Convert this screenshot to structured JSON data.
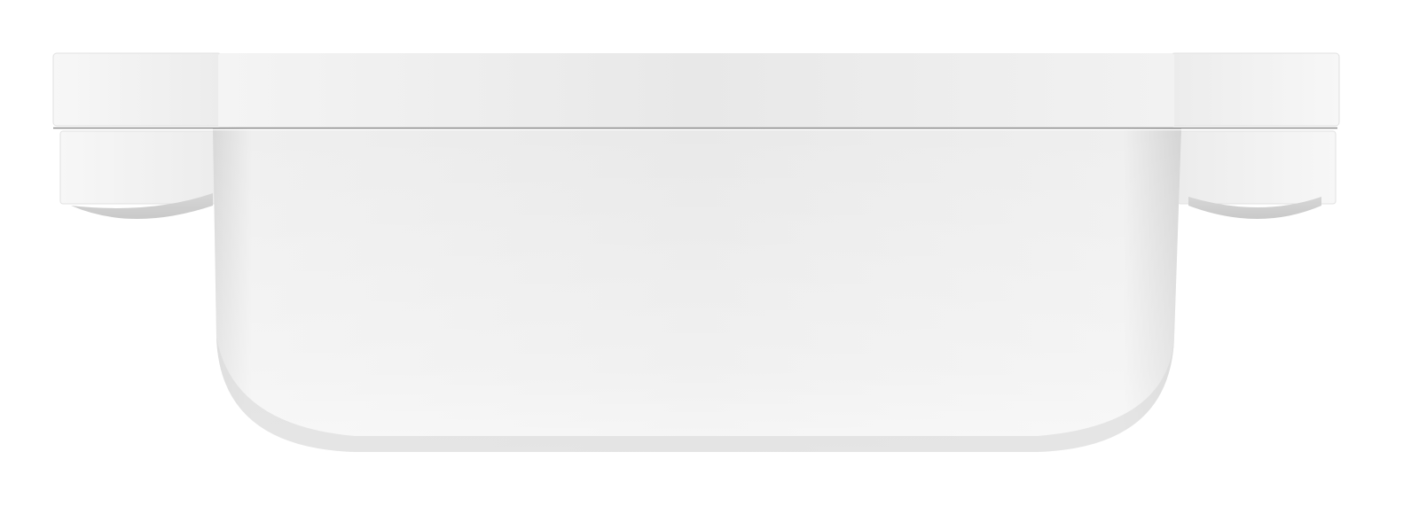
{
  "scene": {
    "subject_icon": "white-enclosure-box-icon",
    "colors": {
      "background": "#ffffff",
      "body_light": "#f3f3f3",
      "body_mid": "#e6e6e6",
      "body_shadow": "#cfcfcf",
      "seam": "#8f8f8f"
    }
  }
}
